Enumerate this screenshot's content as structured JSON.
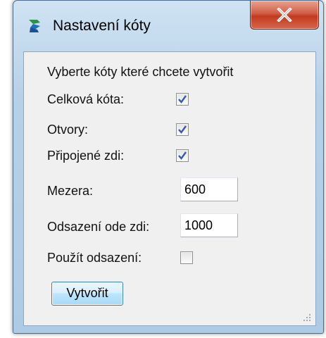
{
  "window": {
    "title": "Nastavení kóty",
    "icons": {
      "app": "app-logo-icon",
      "close": "close-icon",
      "grip": "resize-grip-icon"
    }
  },
  "dialog": {
    "instruction": "Vyberte kóty které chcete vytvořit",
    "options": [
      {
        "label": "Celková kóta:",
        "checked": true
      },
      {
        "label": "Otvory:",
        "checked": true
      },
      {
        "label": "Připojené zdi:",
        "checked": true
      }
    ],
    "spacing": {
      "label": "Mezera:",
      "value": "600"
    },
    "offset": {
      "label": "Odsazení ode zdi:",
      "value": "1000"
    },
    "use_offset": {
      "label": "Použít odsazení:",
      "checked": false
    },
    "create_label": "Vytvořit"
  },
  "colors": {
    "titlebar": "#b6d0e8",
    "close_button": "#c23a1f",
    "client": "#f0f0f0",
    "checkmark": "#3a57b0"
  }
}
